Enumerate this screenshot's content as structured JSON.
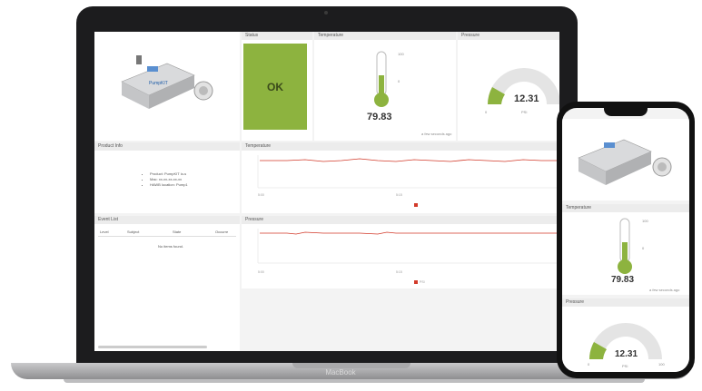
{
  "laptop": {
    "brand": "MacBook"
  },
  "dashboard": {
    "status": {
      "title": "Status",
      "value": "OK",
      "color": "#8db33f"
    },
    "temperature": {
      "title": "Temperature",
      "value": "79.83",
      "scale_max": "100",
      "scale_mid": "0",
      "footnote": "a few seconds ago",
      "level": 0.4
    },
    "pressure": {
      "title": "Pressure",
      "value": "12.31",
      "min": "0",
      "unit": "PSI",
      "fraction": 0.12
    },
    "product_info": {
      "title": "Product Info",
      "items": [
        "Product: PumpKIT io-s",
        "Mac: xx-xx-xx-xx-xx",
        "HAWB location: Pump1"
      ]
    },
    "event_list": {
      "title": "Event List",
      "columns": [
        "Level",
        "Subject",
        "State",
        "Occurre"
      ],
      "empty": "No items found."
    },
    "temp_chart": {
      "title": "Temperature",
      "xtick_left": "5:00",
      "xtick_mid": "5:15"
    },
    "pressure_chart": {
      "title": "Pressure",
      "xtick_left": "5:00",
      "xtick_mid": "5:15",
      "legend": "PSI"
    }
  },
  "phone": {
    "temperature": {
      "title": "Temperature",
      "value": "79.83",
      "scale_max": "100",
      "scale_mid": "0",
      "footnote": "a few seconds ago"
    },
    "pressure": {
      "title": "Pressure",
      "value": "12.31",
      "min": "0",
      "unit": "PSI",
      "max": "100"
    }
  },
  "colors": {
    "accent_green": "#8db33f",
    "series_red": "#d23a2a",
    "panel_header": "#ececec"
  }
}
